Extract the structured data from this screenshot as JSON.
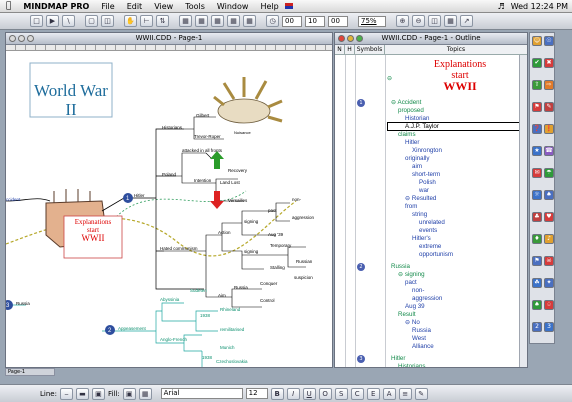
{
  "menubar": {
    "app": "MINDMAP PRO",
    "items": [
      "File",
      "Edit",
      "View",
      "Tools",
      "Window",
      "Help"
    ],
    "clock": "Wed 12:24 PM"
  },
  "toolbar": {
    "zoom_field_1": "00",
    "zoom_field_2": "10",
    "zoom_field_3": "00",
    "zoom_percent": "75%"
  },
  "map_window": {
    "title": "WWII.CDD - Page-1",
    "title_card": "World War II",
    "center_topic": [
      "Explanations",
      "start",
      "WWII"
    ],
    "tab_label": "Page-1",
    "nodes": {
      "accident": "ccident",
      "hitler": "Hitler",
      "russia": "Russia",
      "appeasement": "Appeasement",
      "historians": "Historians",
      "gilbert": "Gilbert",
      "trevor_roper": "Trevor-Roper",
      "cloud": "Nuisance",
      "attacked": "attacked in all fronts",
      "poland": "Poland",
      "intention": "Intention",
      "recovery": "Recovery",
      "land_lost": "Land Lost",
      "versailles": "Versailles",
      "hated_communism": "Hated communism",
      "action": "Action",
      "signing": "signing",
      "pact": "pact",
      "non_aggression": [
        "non-",
        "aggression"
      ],
      "aug39": "Aug '39",
      "signing2": "signing",
      "temporary": "Temporary",
      "stalling": "Stalling",
      "russian": "Russian",
      "suspicion": "suspicion",
      "aim": "Aim",
      "russia_leaf": "Russia",
      "conquer": "Conquer",
      "control": "Control",
      "abyssinia": "Abyssinia",
      "sudeten": "Sudeten",
      "germ": "1938",
      "rhineland": "Rhineland",
      "anglo_french": "Anglo-French",
      "remilitarised": "remilitarised",
      "munich": "Munich",
      "year": "1938",
      "czech": "Czechoslovakia"
    },
    "num_badges": [
      "1",
      "2",
      "3"
    ]
  },
  "outline_window": {
    "title": "WWII.CDD - Page-1 - Outline",
    "headers": [
      "N",
      "H",
      "Symbols",
      "Topics"
    ],
    "topic_title": [
      "Explanations",
      "start",
      "WWII"
    ],
    "rows": [
      {
        "num": "1",
        "text": "Accident",
        "level": 0
      },
      {
        "text": "proposed",
        "level": 1
      },
      {
        "text": "Historian",
        "level": 2
      },
      {
        "text": "A.J.P. Taylor",
        "level": 2,
        "selected": true
      },
      {
        "text": "claims",
        "level": 1
      },
      {
        "text": "Hitler",
        "level": 2
      },
      {
        "text": "Xinrongton",
        "level": 3
      },
      {
        "text": "originally",
        "level": 2
      },
      {
        "text": "aim",
        "level": 3
      },
      {
        "text": "short-term",
        "level": 3
      },
      {
        "text": "Polish",
        "level": 4
      },
      {
        "text": "war",
        "level": 4
      },
      {
        "text": "Resulted",
        "level": 2
      },
      {
        "text": "from",
        "level": 2
      },
      {
        "text": "string",
        "level": 3
      },
      {
        "text": "unrelated",
        "level": 4
      },
      {
        "text": "events",
        "level": 4
      },
      {
        "text": "Hitler's",
        "level": 3
      },
      {
        "text": "extreme",
        "level": 4
      },
      {
        "text": "opportunism",
        "level": 4
      },
      {
        "num": "2",
        "text": "Russia",
        "level": 0
      },
      {
        "text": "signing",
        "level": 1
      },
      {
        "text": "pact",
        "level": 2
      },
      {
        "text": "non-",
        "level": 3
      },
      {
        "text": "aggression",
        "level": 3
      },
      {
        "text": "Aug 39",
        "level": 2
      },
      {
        "text": "Result",
        "level": 1
      },
      {
        "text": "No",
        "level": 2
      },
      {
        "text": "Russia",
        "level": 3
      },
      {
        "text": "West",
        "level": 3
      },
      {
        "text": "Alliance",
        "level": 3
      },
      {
        "num": "3",
        "text": "Hitler",
        "level": 0
      },
      {
        "text": "Historians",
        "level": 1
      }
    ]
  },
  "bottom": {
    "line_label": "Line:",
    "fill_label": "Fill:",
    "font_name": "Arial",
    "font_size": "12",
    "style_buttons": [
      "B",
      "I",
      "U",
      "O",
      "S",
      "C",
      "E"
    ]
  },
  "colors": {
    "title_red": "#dd0000",
    "outline_blue": "#1f3fa8",
    "green": "#138a4a",
    "accent": "#1f6d9c"
  }
}
